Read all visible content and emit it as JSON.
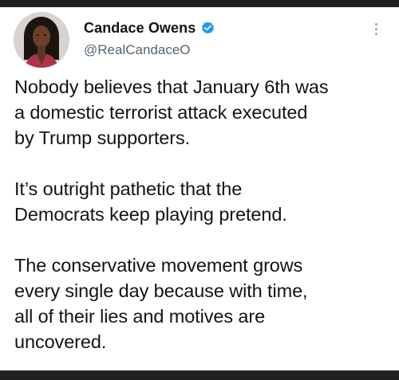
{
  "tweet": {
    "author": {
      "display_name": "Candace Owens",
      "handle": "@RealCandaceO",
      "verified": true
    },
    "paragraphs": [
      [
        "Nobody believes that January 6th was",
        "a domestic terrorist attack executed",
        "by Trump supporters."
      ],
      [
        "It’s outright pathetic that the",
        "Democrats keep playing pretend."
      ],
      [
        "The conservative movement grows",
        "every single day because with time,",
        "all of their lies and motives are",
        "uncovered."
      ]
    ],
    "more_menu_icon": "vertical-ellipsis-icon",
    "verified_icon": "verified-badge-icon"
  },
  "colors": {
    "background": "#ffffff",
    "text": "#0f1419",
    "secondary_text": "#536471",
    "verified_blue": "#1d9bf0",
    "frame": "#202020"
  }
}
